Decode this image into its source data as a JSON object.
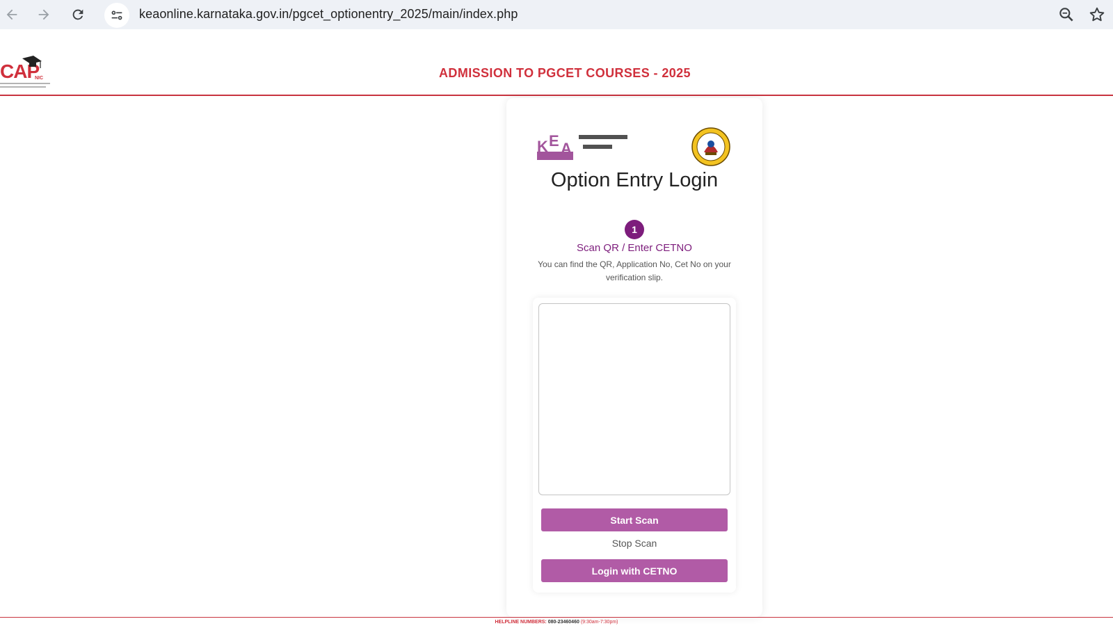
{
  "browser": {
    "url": "keaonline.karnataka.gov.in/pgcet_optionentry_2025/main/index.php",
    "icons": [
      "back-arrow-icon",
      "forward-arrow-icon",
      "reload-icon",
      "site-settings-icon",
      "zoom-icon",
      "bookmark-star-icon"
    ]
  },
  "header": {
    "logo_text": "CAP",
    "logo_sub": "NIC",
    "title": "ADMISSION TO PGCET COURSES - 2025"
  },
  "card": {
    "kea_logo": "KEA",
    "kea_kannada": "ಕರ್ನಾಟಕ ಪರೀಕ್ಷಾ ಪ್ರಾಧಿಕಾರ",
    "title": "Option Entry Login",
    "step_number": "1",
    "step_label": "Scan QR / Enter CETNO",
    "step_hint": "You can find the QR, Application No, Cet No on your verification slip.",
    "start_scan": "Start Scan",
    "stop_scan": "Stop Scan",
    "login_cetno": "Login with CETNO"
  },
  "footer": {
    "helpline_label": "HELPLINE NUMBERS:",
    "helpline_number": "080-23460460",
    "helpline_hours": "(9:30am-7:30pm)"
  },
  "colors": {
    "accent_red": "#d0303c",
    "purple": "#7d1d7c",
    "button": "#b15ba6"
  }
}
